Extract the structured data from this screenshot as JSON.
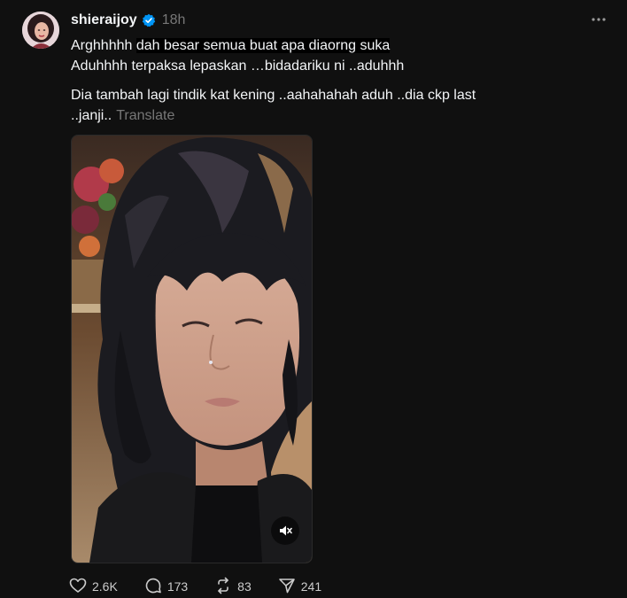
{
  "post": {
    "username": "shieraijoy",
    "timestamp": "18h",
    "text_line1_pre": "Arghhhhh ",
    "text_line1_highlight": "dah besar semua buat apa diaorng suka",
    "text_line2": "Aduhhhh terpaksa lepaskan …bidadariku ni ..aduhhh",
    "text_para2": "Dia tambah lagi tindik kat kening ..aahahahah aduh ..dia ckp last ..janji..",
    "translate_label": "Translate"
  },
  "actions": {
    "likes": "2.6K",
    "replies": "173",
    "reposts": "83",
    "shares": "241"
  },
  "icons": {
    "verified": "verified-badge-icon",
    "more": "more-options-icon",
    "mute": "muted-speaker-icon",
    "like": "heart-icon",
    "reply": "comment-bubble-icon",
    "repost": "repost-icon",
    "share": "send-icon"
  },
  "colors": {
    "background": "#101010",
    "text_primary": "#f3f5f7",
    "text_secondary": "#777777",
    "verified_blue": "#0095f6"
  }
}
